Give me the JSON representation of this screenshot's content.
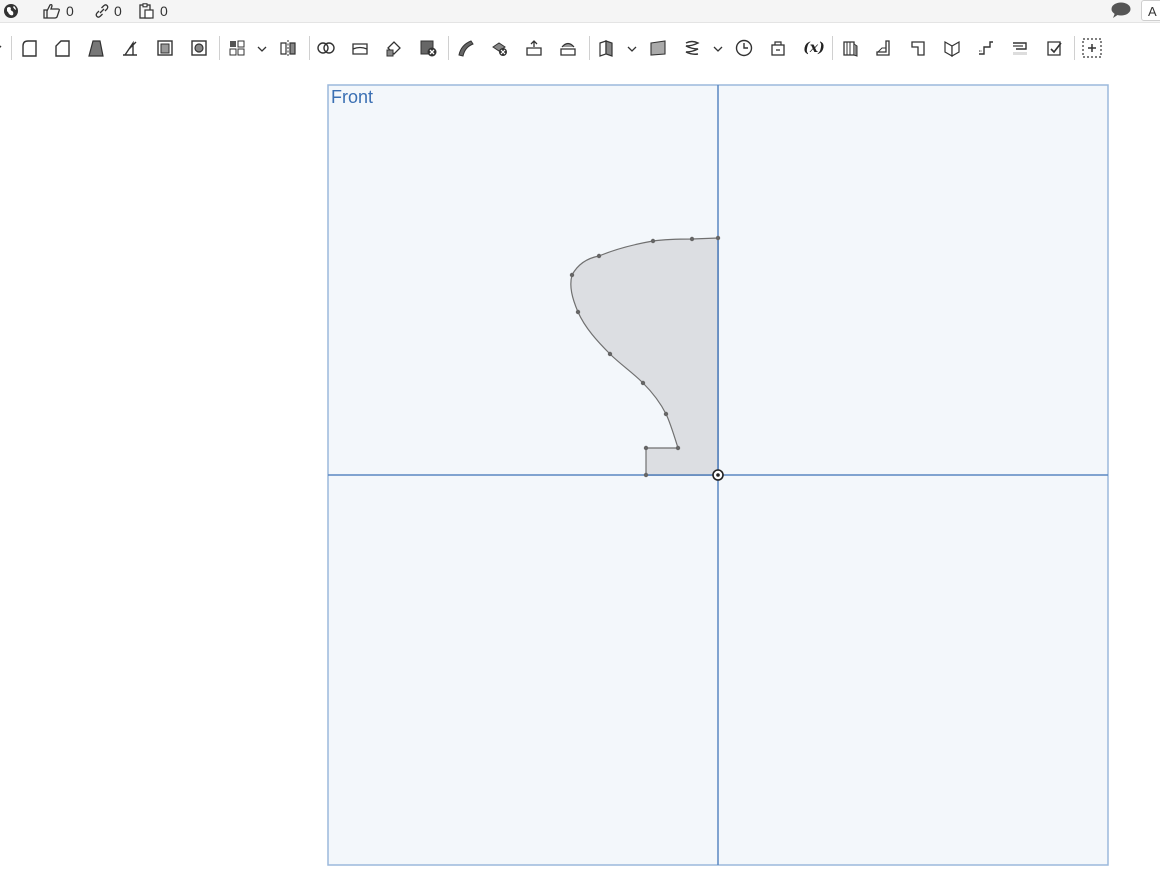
{
  "topbar": {
    "likes_count": "0",
    "links_count": "0",
    "copies_count": "0",
    "right_field_text": "A"
  },
  "toolbar": {
    "tools": [
      "sketch-icon",
      "fillet-icon",
      "chamfer-icon",
      "draft-icon",
      "rib-icon",
      "shell-icon",
      "hole-icon",
      "linear-pattern-icon",
      "mirror-icon",
      "boolean-icon",
      "split-icon",
      "transform-icon",
      "delete-part-icon",
      "modify-fillet-icon",
      "delete-face-icon",
      "move-face-icon",
      "replace-face-icon",
      "plane-icon",
      "offset-surface-icon",
      "helix-icon",
      "mate-connector-icon",
      "measure-icon",
      "variable-icon",
      "sheet-metal-icon",
      "flange-icon",
      "tab-icon",
      "corner-icon",
      "joggle-icon",
      "hem-icon",
      "finish-sheet-icon",
      "add-custom-feature-icon"
    ],
    "variable_label": "(x)"
  },
  "viewport": {
    "plane_label": "Front",
    "colors": {
      "plane_fill": "#f3f7fb",
      "plane_border": "#9bb8dc",
      "axis": "#5b87c2",
      "profile_fill": "#dcdee2",
      "profile_stroke": "#707070"
    }
  }
}
